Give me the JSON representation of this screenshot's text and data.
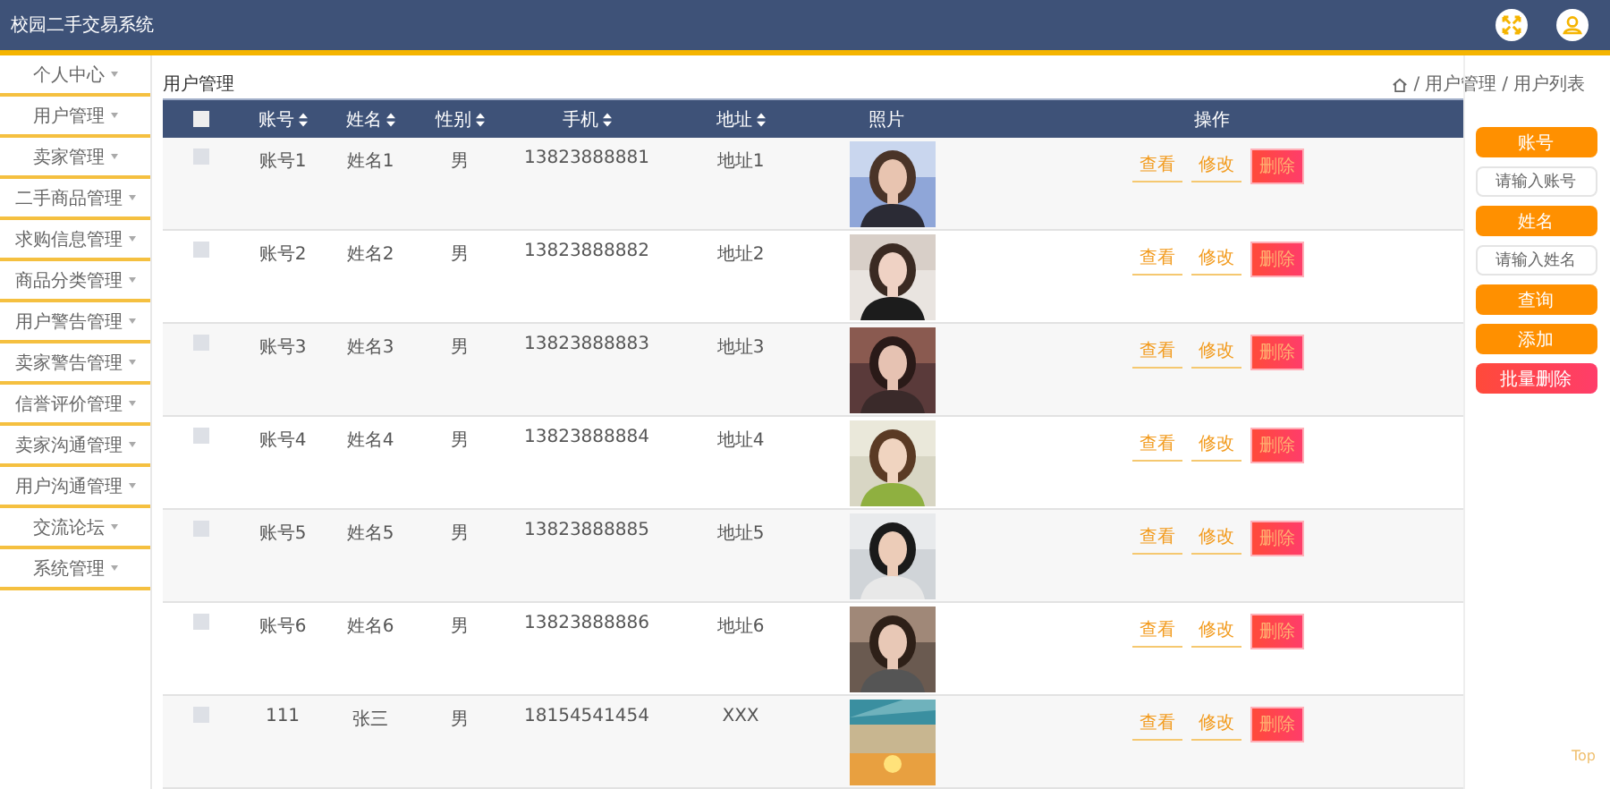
{
  "header": {
    "title": "校园二手交易系统"
  },
  "sidebar": {
    "items": [
      {
        "label": "个人中心"
      },
      {
        "label": "用户管理"
      },
      {
        "label": "卖家管理"
      },
      {
        "label": "二手商品管理"
      },
      {
        "label": "求购信息管理"
      },
      {
        "label": "商品分类管理"
      },
      {
        "label": "用户警告管理"
      },
      {
        "label": "卖家警告管理"
      },
      {
        "label": "信誉评价管理"
      },
      {
        "label": "卖家沟通管理"
      },
      {
        "label": "用户沟通管理"
      },
      {
        "label": "交流论坛"
      },
      {
        "label": "系统管理"
      }
    ]
  },
  "page_title": "用户管理",
  "breadcrumb": [
    {
      "separator": "/",
      "label": "用户管理"
    },
    {
      "separator": "/",
      "label": "用户列表"
    }
  ],
  "table": {
    "select_all_checked": false,
    "columns": [
      {
        "label": "账号",
        "sortable": true
      },
      {
        "label": "姓名",
        "sortable": true
      },
      {
        "label": "性别",
        "sortable": true
      },
      {
        "label": "手机",
        "sortable": true
      },
      {
        "label": "地址",
        "sortable": true
      },
      {
        "label": "照片",
        "sortable": false
      },
      {
        "label": "操作",
        "sortable": false
      }
    ],
    "rows": [
      {
        "checked": false,
        "account": "账号1",
        "name": "姓名1",
        "gender": "男",
        "phone": "13823888881",
        "address": "地址1",
        "actions": {
          "view": "查看",
          "edit": "修改",
          "delete": "删除"
        }
      },
      {
        "checked": false,
        "account": "账号2",
        "name": "姓名2",
        "gender": "男",
        "phone": "13823888882",
        "address": "地址2",
        "actions": {
          "view": "查看",
          "edit": "修改",
          "delete": "删除"
        }
      },
      {
        "checked": false,
        "account": "账号3",
        "name": "姓名3",
        "gender": "男",
        "phone": "13823888883",
        "address": "地址3",
        "actions": {
          "view": "查看",
          "edit": "修改",
          "delete": "删除"
        }
      },
      {
        "checked": false,
        "account": "账号4",
        "name": "姓名4",
        "gender": "男",
        "phone": "13823888884",
        "address": "地址4",
        "actions": {
          "view": "查看",
          "edit": "修改",
          "delete": "删除"
        }
      },
      {
        "checked": false,
        "account": "账号5",
        "name": "姓名5",
        "gender": "男",
        "phone": "13823888885",
        "address": "地址5",
        "actions": {
          "view": "查看",
          "edit": "修改",
          "delete": "删除"
        }
      },
      {
        "checked": false,
        "account": "账号6",
        "name": "姓名6",
        "gender": "男",
        "phone": "13823888886",
        "address": "地址6",
        "actions": {
          "view": "查看",
          "edit": "修改",
          "delete": "删除"
        }
      },
      {
        "checked": false,
        "account": "111",
        "name": "张三",
        "gender": "男",
        "phone": "18154541454",
        "address": "XXX",
        "actions": {
          "view": "查看",
          "edit": "修改",
          "delete": "删除"
        }
      }
    ]
  },
  "search_panel": {
    "items": [
      {
        "kind": "label",
        "text": "账号"
      },
      {
        "kind": "input",
        "placeholder": "请输入账号"
      },
      {
        "kind": "label",
        "text": "姓名"
      },
      {
        "kind": "input",
        "placeholder": "请输入姓名"
      },
      {
        "kind": "button",
        "text": "查询"
      },
      {
        "kind": "button",
        "text": "添加"
      },
      {
        "kind": "danger",
        "text": "批量删除"
      }
    ]
  },
  "back_to_top": "Top"
}
